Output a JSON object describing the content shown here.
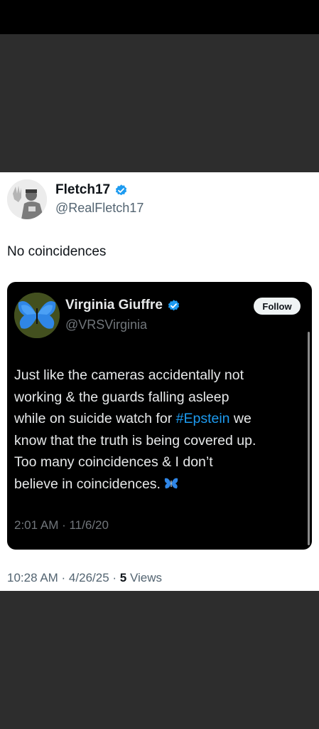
{
  "post": {
    "author_name": "Fletch17",
    "author_handle": "@RealFletch17",
    "text": "No coincidences",
    "timestamp": "10:28 AM · 4/26/25 · ",
    "views_count": "5",
    "views_label": " Views"
  },
  "quoted": {
    "author_name": "Virginia Giuffre",
    "author_handle": "@VRSVirginia",
    "follow_label": "Follow",
    "body": {
      "line1": "Just like the cameras accidentally not",
      "line2": "working & the guards falling asleep",
      "line3_before": "while on suicide watch for ",
      "hashtag": "#Epstein",
      "line3_after": " we",
      "line4": "know that the truth is being covered up.",
      "line5": "Too many coincidences & I don’t",
      "line6": "believe in coincidences. "
    },
    "timestamp": "2:01 AM · 11/6/20"
  },
  "colors": {
    "verified": "#1d9bf0",
    "hashtag": "#1d9bf0",
    "butterfly": "#2f86e6"
  }
}
